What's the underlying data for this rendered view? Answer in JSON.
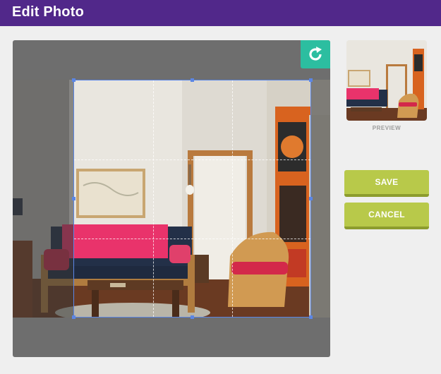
{
  "header": {
    "title": "Edit Photo",
    "background": "#51288a"
  },
  "editor": {
    "rotate_icon": "rotate-clockwise-icon",
    "accent": "#2cbea0",
    "crop_border_color": "#5b86e5",
    "photo_description": "Living room with pink throw on navy futon, wicker chair and colorful wall art"
  },
  "preview": {
    "label": "PREVIEW"
  },
  "actions": {
    "save_label": "SAVE",
    "cancel_label": "CANCEL",
    "button_color": "#b8c94a"
  }
}
